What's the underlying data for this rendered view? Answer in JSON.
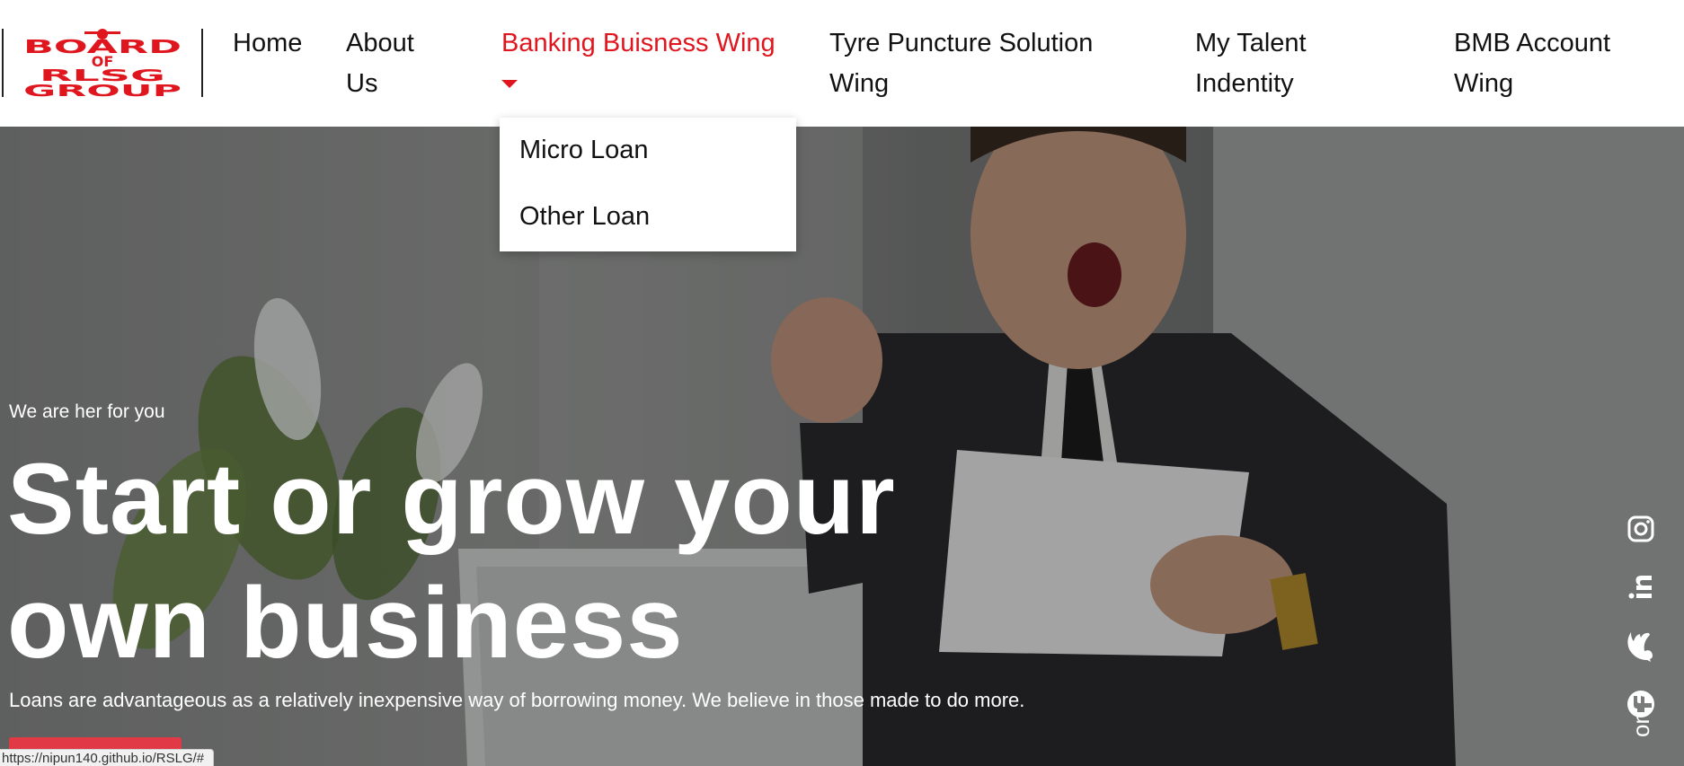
{
  "logo": {
    "text_lines": [
      "BOARD",
      "OF",
      "RLSG",
      "GROUP"
    ],
    "color": "#e0161f"
  },
  "nav": {
    "home": "Home",
    "about_line1": "About",
    "about_line2": "Us",
    "banking": "Banking Buisness Wing",
    "tyre_line1": "Tyre Puncture Solution",
    "tyre_line2": "Wing",
    "talent_line1": "My Talent",
    "talent_line2": "Indentity",
    "bmb_line1": "BMB Account",
    "bmb_line2": "Wing",
    "active_color": "#e0161f"
  },
  "dropdown": {
    "items": [
      "Micro Loan",
      "Other Loan"
    ]
  },
  "hero": {
    "eyebrow": "We are her for you",
    "headline_line1": "Start or grow your",
    "headline_line2": "own business",
    "subtext": "Loans are advantageous as a relatively inexpensive way of borrowing money. We believe in those made to do more.",
    "cta_color": "#e13a46"
  },
  "social": {
    "icons": [
      "instagram-icon",
      "linkedin-icon",
      "twitter-icon",
      "facebook-icon"
    ],
    "partial_text": "on"
  },
  "status_bar": {
    "url": "https://nipun140.github.io/RSLG/#"
  }
}
